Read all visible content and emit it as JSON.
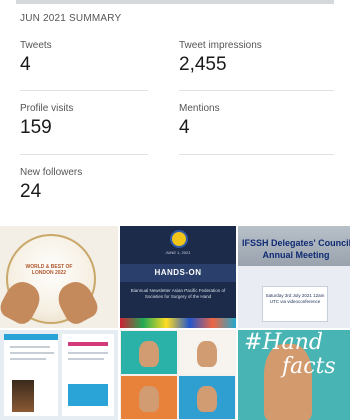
{
  "summary": {
    "title": "JUN 2021 SUMMARY",
    "tweets": {
      "label": "Tweets",
      "value": "4"
    },
    "impressions": {
      "label": "Tweet impressions",
      "value": "2,455"
    },
    "profile_visits": {
      "label": "Profile visits",
      "value": "159"
    },
    "mentions": {
      "label": "Mentions",
      "value": "4"
    },
    "new_followers": {
      "label": "New followers",
      "value": "24"
    }
  },
  "media": {
    "tile1": {
      "text": "WORLD & BEST OF LONDON 2022"
    },
    "tile2": {
      "date": "JUNE 1, 2021",
      "headline": "HANDS-ON",
      "subtitle": "Biannual Newsletter Asian Pacific Federation of Societies for Surgery of the Hand"
    },
    "tile3": {
      "headline_1": "IFSSH Delegates' Council",
      "headline_2": "Annual Meeting",
      "info": "Saturday 3rd July 2021 12am UTC via videoconference"
    },
    "tile6": {
      "word_1": "#Hand",
      "word_2": "facts"
    }
  }
}
